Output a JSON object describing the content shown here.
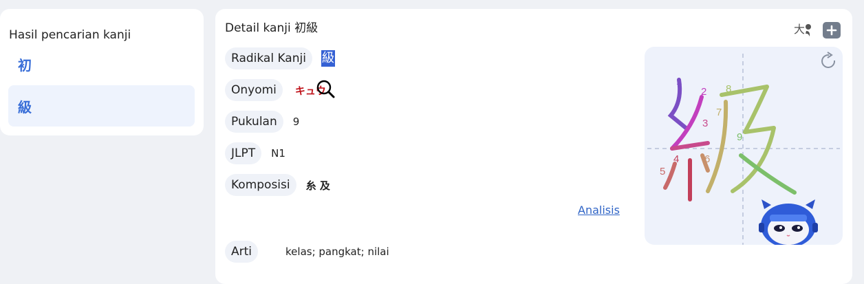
{
  "sidebar": {
    "title": "Hasil pencarian kanji",
    "items": [
      {
        "label": "初"
      },
      {
        "label": "級"
      }
    ]
  },
  "detail": {
    "title": "Detail kanji 初級",
    "rows": {
      "radikal": {
        "label": "Radikal Kanji",
        "value": "級"
      },
      "onyomi": {
        "label": "Onyomi",
        "value": "キュウ"
      },
      "pukulan": {
        "label": "Pukulan",
        "value": "9"
      },
      "jlpt": {
        "label": "JLPT",
        "value": "N1"
      },
      "komposisi": {
        "label": "Komposisi",
        "value": "糸 及"
      },
      "arti": {
        "label": "Arti",
        "value": "kelas; pangkat; nilai"
      }
    },
    "analisis_link": "Analisis"
  },
  "toolbar": {
    "font_size_icon_text": "大"
  },
  "stroke_order": {
    "character": "級",
    "numbers": [
      "1",
      "2",
      "3",
      "4",
      "5",
      "6",
      "7",
      "8",
      "9"
    ]
  },
  "colors": {
    "accent": "#3a6fd8",
    "onyomi": "#c0141c",
    "link": "#2f64c6"
  }
}
